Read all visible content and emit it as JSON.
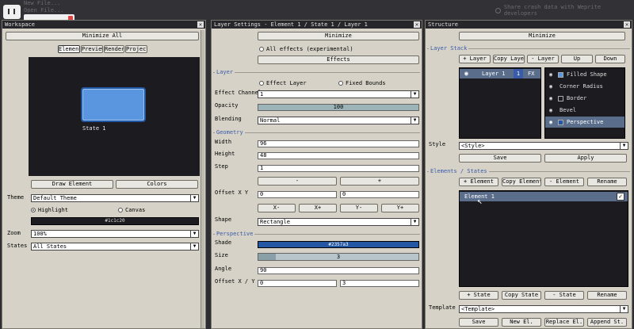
{
  "topbar": {
    "menu_new": "New File...",
    "menu_open": "Open File...",
    "crash_text": "Share crash data with Weprite developers"
  },
  "workspace": {
    "title": "Workspace",
    "minimize": "Minimize All",
    "tabs": [
      "Element",
      "Preview",
      "Render",
      "Project"
    ],
    "preview_label": "State 1",
    "draw_element": "Draw Element",
    "colors": "Colors",
    "theme_label": "Theme",
    "theme_value": "Default Theme",
    "highlight": "Highlight",
    "canvas": "Canvas",
    "color_value": "#1c1c20",
    "zoom_label": "Zoom",
    "zoom_value": "100%",
    "states_label": "States",
    "states_value": "All States"
  },
  "layer_settings": {
    "title": "Layer Settings - Element 1 / State 1 / Layer 1",
    "minimize": "Minimize",
    "all_effects": "All effects (experimental)",
    "effects": "Effects",
    "layer_section": "Layer",
    "effect_layer": "Effect Layer",
    "fixed_bounds": "Fixed Bounds",
    "effect_channel_label": "Effect Channel",
    "effect_channel_value": "1",
    "opacity_label": "Opacity",
    "opacity_value": "100",
    "blending_label": "Blending",
    "blending_value": "Normal",
    "geometry_section": "Geometry",
    "width_label": "Width",
    "width_value": "96",
    "height_label": "Height",
    "height_value": "48",
    "step_label": "Step",
    "step_value": "1",
    "minus": "-",
    "plus": "+",
    "offset_label": "Offset X Y",
    "offset_x": "0",
    "offset_y": "0",
    "xminus": "X-",
    "xplus": "X+",
    "yminus": "Y-",
    "yplus": "Y+",
    "shape_label": "Shape",
    "shape_value": "Rectangle",
    "perspective_section": "Perspective",
    "shade_label": "Shade",
    "shade_value": "#2357a3",
    "size_label": "Size",
    "size_value": "3",
    "angle_label": "Angle",
    "angle_value": "90",
    "poffset_label": "Offset X / Y",
    "poffset_x": "0",
    "poffset_y": "3"
  },
  "structure": {
    "title": "Structure",
    "minimize": "Minimize",
    "layer_stack_section": "Layer Stack",
    "add_layer": "+ Layer",
    "copy_layer": "Copy Layer",
    "remove_layer": "- Layer",
    "up": "Up",
    "down": "Down",
    "layer_name": "Layer 1",
    "layer_num": "1",
    "layer_fx": "FX",
    "effects": [
      "Filled Shape",
      "Corner Radius",
      "Border",
      "Bevel",
      "Perspective"
    ],
    "style_label": "Style",
    "style_value": "<Style>",
    "save": "Save",
    "apply": "Apply",
    "elements_section": "Elements / States",
    "add_element": "+ Element",
    "copy_element": "Copy Element",
    "remove_element": "- Element",
    "rename": "Rename",
    "element_name": "Element 1",
    "add_state": "+ State",
    "copy_state": "Copy State",
    "remove_state": "- State",
    "rename2": "Rename",
    "template_label": "Template",
    "template_value": "<Template>",
    "save2": "Save",
    "new_el": "New El.",
    "replace_el": "Replace El.",
    "append_st": "Append St."
  },
  "colors": {
    "accent": "#3a5ca8",
    "element_fill": "#5a95e0",
    "preview_bg": "#1c1c20",
    "shade": "#2357a3"
  }
}
